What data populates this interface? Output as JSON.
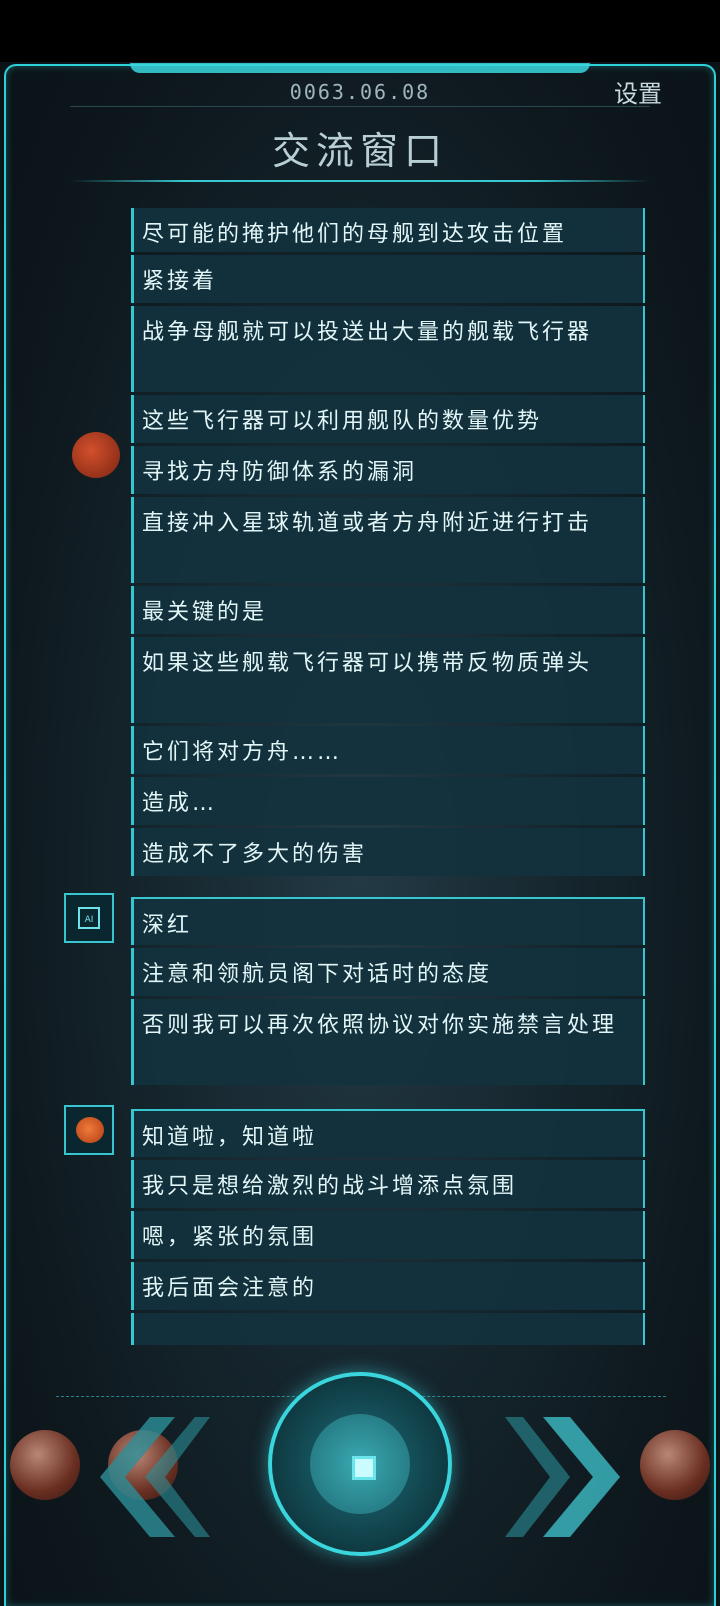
{
  "header": {
    "date": "0063.06.08",
    "settings_label": "设置",
    "title": "交流窗口"
  },
  "messages": [
    {
      "text": "尽可能的掩护他们的母舰到达攻击位置"
    },
    {
      "text": "紧接着"
    },
    {
      "text": "战争母舰就可以投送出大量的舰载飞行器"
    },
    {
      "text": "这些飞行器可以利用舰队的数量优势"
    },
    {
      "text": "寻找方舟防御体系的漏洞"
    },
    {
      "text": "直接冲入星球轨道或者方舟附近进行打击"
    },
    {
      "text": "最关键的是"
    },
    {
      "text": "如果这些舰载飞行器可以携带反物质弹头"
    },
    {
      "text": "它们将对方舟……"
    },
    {
      "text": "造成…"
    },
    {
      "text": "造成不了多大的伤害"
    },
    {
      "text": "深红"
    },
    {
      "text": "注意和领航员阁下对话时的态度"
    },
    {
      "text": "否则我可以再次依照协议对你实施禁言处理"
    },
    {
      "text": "知道啦，知道啦"
    },
    {
      "text": "我只是想给激烈的战斗增添点氛围"
    },
    {
      "text": "嗯，紧张的氛围"
    },
    {
      "text": "我后面会注意的"
    }
  ],
  "avatars": {
    "ai_label": "AI",
    "ai_icon": "ai-chip-icon",
    "player_icon": "brain-circuit-icon"
  },
  "controls": {
    "prev_icon": "double-chevron-left-icon",
    "next_icon": "double-chevron-right-icon",
    "center_icon": "stop-square-icon"
  },
  "colors": {
    "accent": "#35c6cf",
    "bubble": "#12323e",
    "text": "#e2f6f8"
  }
}
